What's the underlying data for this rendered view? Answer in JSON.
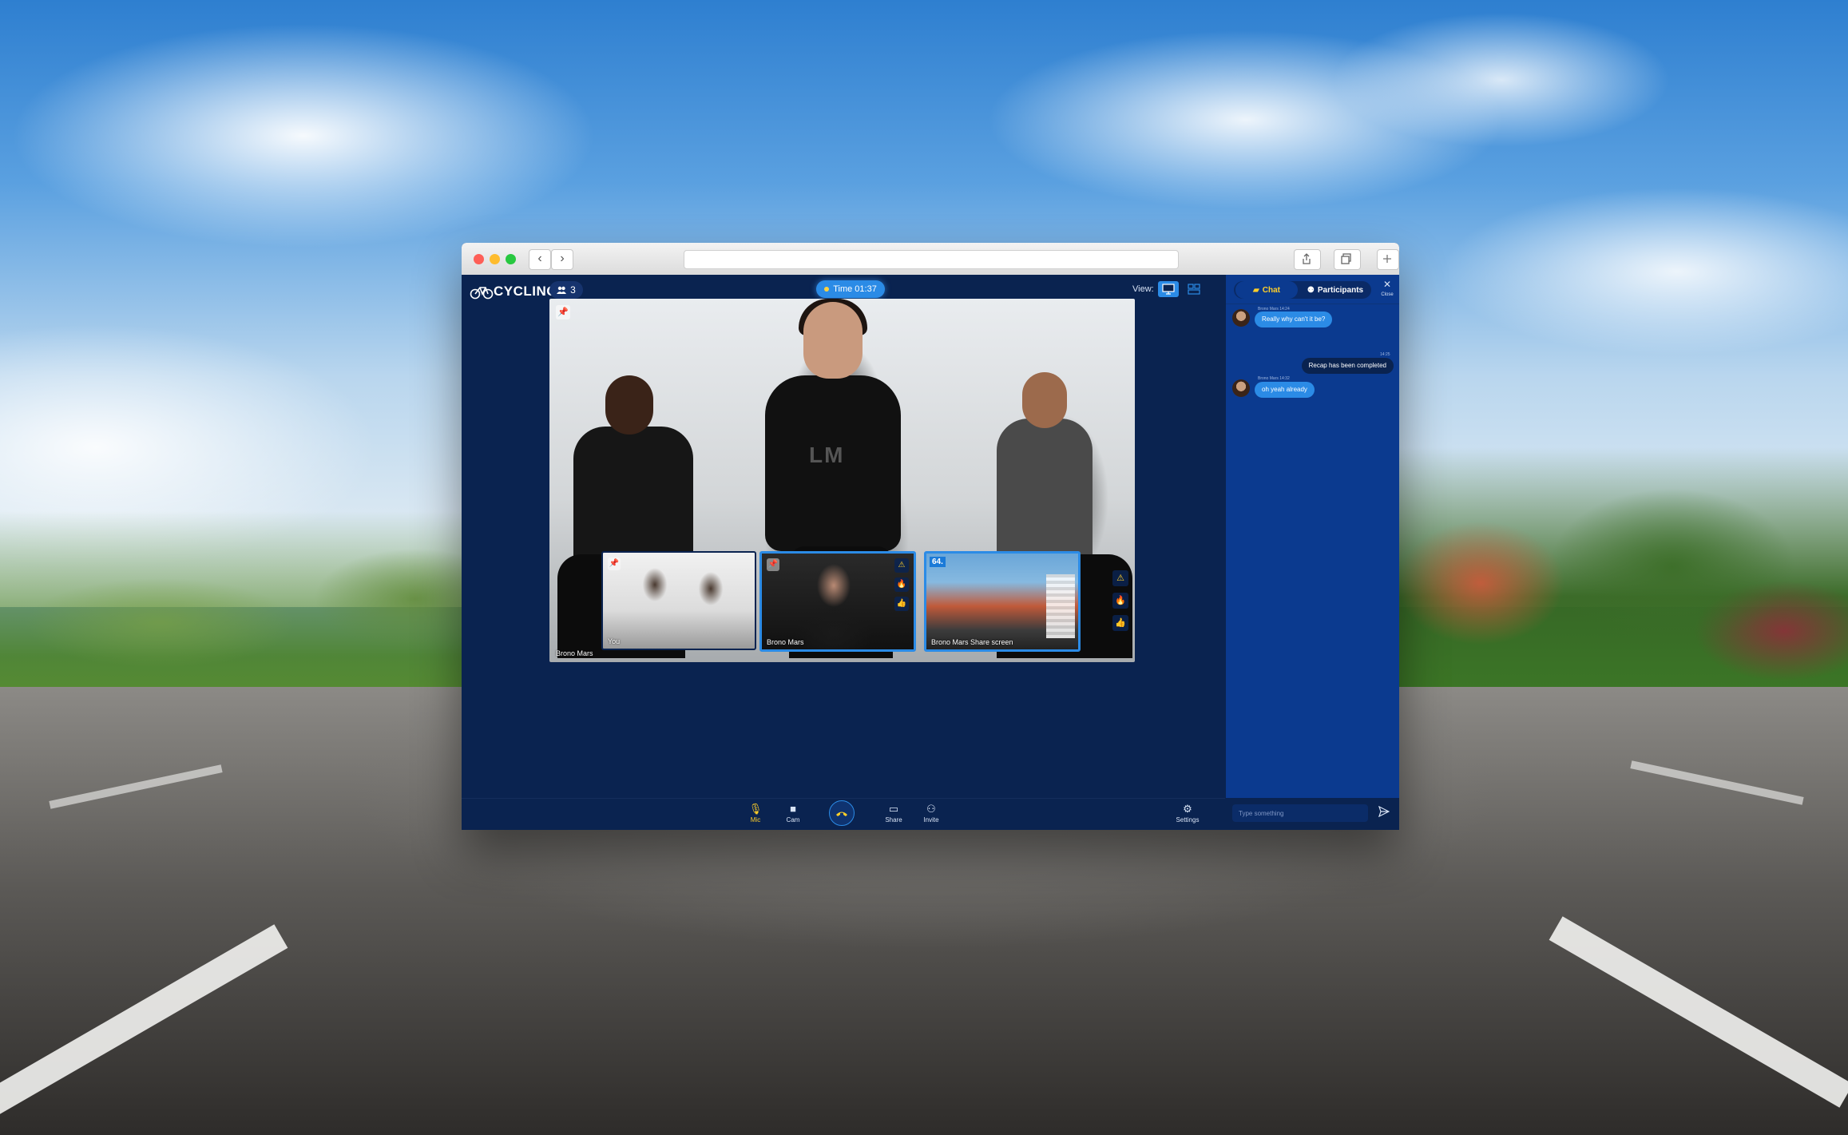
{
  "browser": {
    "back_glyph": "‹",
    "forward_glyph": "›"
  },
  "app": {
    "logo_text": "CYCLING",
    "participant_count": "3",
    "timer": "Time 01:37",
    "view_label": "View:"
  },
  "main_video": {
    "participant_name": "Brono Mars",
    "shirt_text": "LM",
    "reactions": [
      "warning-icon",
      "fire-icon",
      "thumbs-up-icon"
    ]
  },
  "thumbnails": [
    {
      "name": "You",
      "pinned": true
    },
    {
      "name": "Brono Mars",
      "pinned": true,
      "reactions": [
        "warning-icon",
        "fire-icon",
        "thumbs-up-icon"
      ]
    },
    {
      "name": "Brono Mars Share screen",
      "hud": "64."
    }
  ],
  "toolbar": {
    "mic": "Mic",
    "cam": "Cam",
    "share": "Share",
    "invite": "Invite",
    "settings": "Settings"
  },
  "sidebar": {
    "tabs": {
      "chat": "Chat",
      "participants": "Participants"
    },
    "close_label": "Close",
    "messages": [
      {
        "sender": "Brono Mars 14:24",
        "text": "Really why can't it be?",
        "direction": "incoming"
      },
      {
        "time": "14:25",
        "text": "Recap has been completed",
        "direction": "outgoing"
      },
      {
        "sender": "Brono Mars 14:32",
        "text": "oh yeah already",
        "direction": "incoming"
      }
    ],
    "input_placeholder": "Type something"
  },
  "colors": {
    "app_bg": "#0a2350",
    "sidebar_bg": "#0b3a8f",
    "accent": "#2b8be6",
    "highlight": "#ffcf29"
  }
}
